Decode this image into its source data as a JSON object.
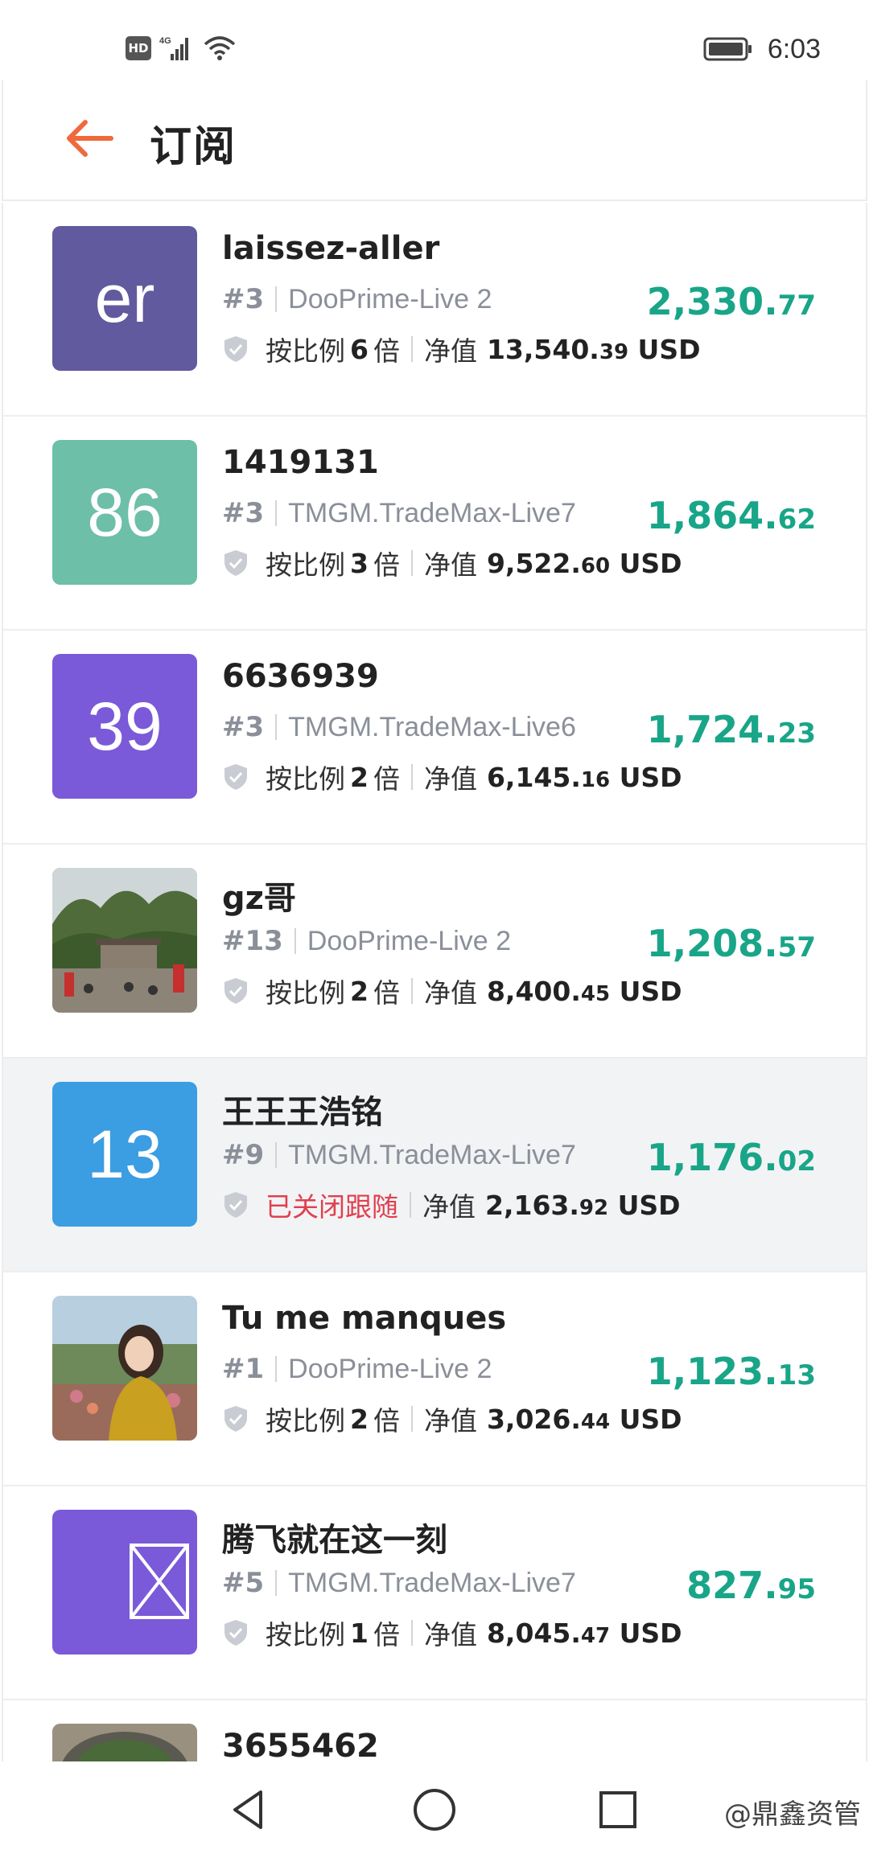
{
  "status_bar": {
    "hd": "HD",
    "network": "4G",
    "time": "6:03"
  },
  "header": {
    "title": "订阅"
  },
  "labels": {
    "ratio_prefix": "按比例",
    "ratio_suffix": "倍",
    "equity": "净值",
    "currency": "USD"
  },
  "items": [
    {
      "name": "laissez-aller",
      "rank": "#3",
      "server": "DooPrime-Live 2",
      "ratio": "6",
      "closed": false,
      "equity_int": "13,540.",
      "equity_dec": "39",
      "profit_int": "2,330.",
      "profit_dec": "77",
      "avatar_text": "er",
      "avatar_color": "#625a9e"
    },
    {
      "name": "1419131",
      "rank": "#3",
      "server": "TMGM.TradeMax-Live7",
      "ratio": "3",
      "closed": false,
      "equity_int": "9,522.",
      "equity_dec": "60",
      "profit_int": "1,864.",
      "profit_dec": "62",
      "avatar_text": "86",
      "avatar_color": "#6dbfa8"
    },
    {
      "name": "6636939",
      "rank": "#3",
      "server": "TMGM.TradeMax-Live6",
      "ratio": "2",
      "closed": false,
      "equity_int": "6,145.",
      "equity_dec": "16",
      "profit_int": "1,724.",
      "profit_dec": "23",
      "avatar_text": "39",
      "avatar_color": "#7a5ad8"
    },
    {
      "name": "gz哥",
      "rank": "#13",
      "server": "DooPrime-Live 2",
      "ratio": "2",
      "closed": false,
      "equity_int": "8,400.",
      "equity_dec": "45",
      "profit_int": "1,208.",
      "profit_dec": "57",
      "avatar_text": "",
      "avatar_color": "#5c7a4a"
    },
    {
      "name": "王王王浩铭",
      "rank": "#9",
      "server": "TMGM.TradeMax-Live7",
      "ratio": "",
      "closed": true,
      "closed_label": "已关闭跟随",
      "equity_int": "2,163.",
      "equity_dec": "92",
      "profit_int": "1,176.",
      "profit_dec": "02",
      "avatar_text": "13",
      "avatar_color": "#3b9de2"
    },
    {
      "name": "Tu me manques",
      "rank": "#1",
      "server": "DooPrime-Live 2",
      "ratio": "2",
      "closed": false,
      "equity_int": "3,026.",
      "equity_dec": "44",
      "profit_int": "1,123.",
      "profit_dec": "13",
      "avatar_text": "",
      "avatar_color": "#a9c2d6"
    },
    {
      "name": "腾飞就在这一刻",
      "rank": "#5",
      "server": "TMGM.TradeMax-Live7",
      "ratio": "1",
      "closed": false,
      "equity_int": "8,045.",
      "equity_dec": "47",
      "profit_int": "827.",
      "profit_dec": "95",
      "avatar_text": "",
      "avatar_color": "#7a5ad8"
    },
    {
      "name": "3655462",
      "rank": "",
      "server": "",
      "ratio": "",
      "closed": false,
      "equity_int": "",
      "equity_dec": "",
      "profit_int": "",
      "profit_dec": "",
      "avatar_text": "",
      "avatar_color": "#8a8f7a"
    }
  ],
  "watermark": "@鼎鑫资管",
  "colors": {
    "accent": "#ee6a3c",
    "profit": "#19a588",
    "closed": "#e0404e",
    "muted": "#8a8f99"
  }
}
